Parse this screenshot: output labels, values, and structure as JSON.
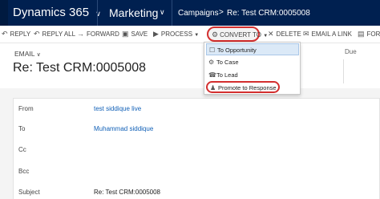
{
  "topbar": {
    "app_title": "Dynamics 365",
    "app_chevron": "∨",
    "area": "Marketing",
    "area_chevron": "∨",
    "breadcrumb": [
      "Campaigns",
      "Re: Test CRM:0005008"
    ],
    "breadcrumb_sep": ">"
  },
  "commands": {
    "reply": "REPLY",
    "reply_all": "REPLY ALL",
    "forward": "FORWARD",
    "save": "SAVE",
    "process": "PROCESS",
    "convert_to": "CONVERT TO",
    "delete": "DELETE",
    "email_link": "EMAIL A LINK",
    "form": "FORM"
  },
  "record": {
    "entity_type": "EMAIL",
    "type_chevron": "∨",
    "title": "Re: Test CRM:0005008",
    "due_label": "Due"
  },
  "fields": [
    {
      "label": "From",
      "value": "test siddique live",
      "kind": "link"
    },
    {
      "label": "To",
      "value": "Muhammad siddique",
      "kind": "link"
    },
    {
      "label": "Cc",
      "value": "",
      "kind": "plain"
    },
    {
      "label": "Bcc",
      "value": "",
      "kind": "plain"
    },
    {
      "label": "Subject",
      "value": "Re: Test CRM:0005008",
      "kind": "plain"
    }
  ],
  "dropdown": {
    "items": [
      {
        "label": "To Opportunity",
        "icon": "opportunity-icon"
      },
      {
        "label": "To Case",
        "icon": "case-icon"
      },
      {
        "label": "To Lead",
        "icon": "lead-icon"
      },
      {
        "label": "Promote to Response",
        "icon": "promote-icon"
      }
    ]
  },
  "colors": {
    "nav_bg": "#002050",
    "link": "#1160b7",
    "highlight_circle": "#d32f2f",
    "menu_selected": "#dbe9f7"
  }
}
